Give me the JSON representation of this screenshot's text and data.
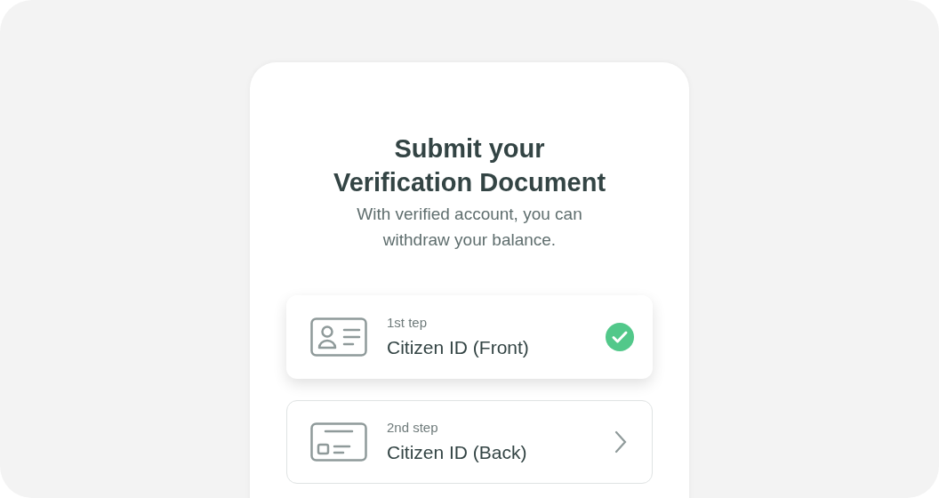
{
  "title_lines": [
    "Submit your",
    "Verification Document"
  ],
  "subtitle": "With verified account, you can withdraw your balance.",
  "steps": [
    {
      "kind": "front",
      "step_label": "1st tep",
      "name": "Citizen ID (Front)",
      "completed": true
    },
    {
      "kind": "back",
      "step_label": "2nd step",
      "name": "Citizen ID (Back)",
      "completed": false
    }
  ]
}
